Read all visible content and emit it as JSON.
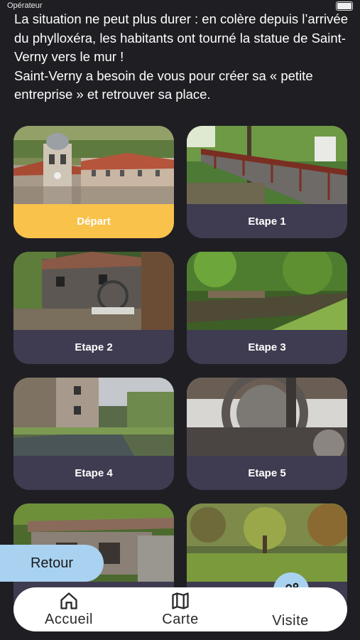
{
  "status_bar": {
    "carrier": "Opérateur"
  },
  "intro": {
    "text_line1": "La situation ne peut plus durer : en colère depuis l’arrivée du phylloxéra, les habitants ont tourné la statue de Saint-Verny vers le mur !",
    "text_line2": "Saint-Verny a besoin de vous pour créer sa « petite entreprise » et retrouver sa place."
  },
  "stages": [
    {
      "label": "Départ"
    },
    {
      "label": "Etape 1"
    },
    {
      "label": "Etape 2"
    },
    {
      "label": "Etape 3"
    },
    {
      "label": "Etape 4"
    },
    {
      "label": "Etape 5"
    }
  ],
  "back_button": {
    "label": "Retour"
  },
  "nav": {
    "home": {
      "label": "Accueil",
      "icon": "home-icon"
    },
    "map": {
      "label": "Carte",
      "icon": "map-icon"
    },
    "visit": {
      "label": "Visite",
      "icon": "route-icon"
    }
  },
  "colors": {
    "background": "#1f1e23",
    "card": "#3f3b50",
    "accent_yellow": "#f8c24b",
    "accent_blue": "#a9d2f1"
  }
}
